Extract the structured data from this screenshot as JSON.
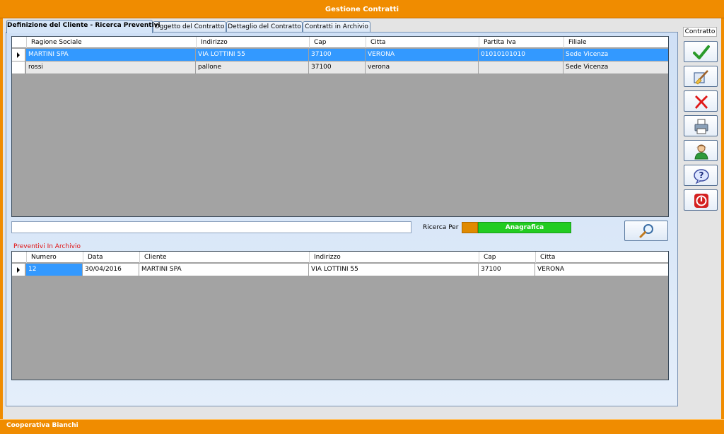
{
  "window": {
    "title": "Gestione Contratti"
  },
  "tabs": [
    {
      "label": "Definizione del Cliente - Ricerca Preventivi"
    },
    {
      "label": "Oggetto del Contratto"
    },
    {
      "label": "Dettaglio del Contratto"
    },
    {
      "label": "Contratti in Archivio"
    }
  ],
  "clients_grid": {
    "columns": [
      "Ragione Sociale",
      "Indirizzo",
      "Cap",
      "Citta",
      "Partita Iva",
      "Filiale"
    ],
    "rows": [
      [
        "MARTINI SPA",
        "VIA LOTTINI 55",
        "37100",
        "VERONA",
        "01010101010",
        "Sede Vicenza"
      ],
      [
        "rossi",
        "pallone",
        "37100",
        "verona",
        "",
        "Sede Vicenza"
      ]
    ]
  },
  "search": {
    "value": "",
    "ricerca_label": "Ricerca Per",
    "mode_button": "Anagrafica"
  },
  "preventivi": {
    "section_label": "Preventivi In Archivio",
    "columns": [
      "Numero",
      "Data",
      "Cliente",
      "Indirizzo",
      "Cap",
      "Citta"
    ],
    "rows": [
      [
        "12",
        "30/04/2016",
        "MARTINI SPA",
        "VIA LOTTINI 55",
        "37100",
        "VERONA"
      ]
    ]
  },
  "toolbar": {
    "title": "Contratto",
    "buttons": [
      "confirm-check-icon",
      "clean-brush-icon",
      "delete-x-icon",
      "print-icon",
      "user-icon",
      "help-icon",
      "exit-power-icon"
    ]
  },
  "status": {
    "company": "Cooperativa Bianchi"
  },
  "colors": {
    "accent": "#f08c00",
    "selection": "#3399ff",
    "mode_green": "#22cc22"
  }
}
